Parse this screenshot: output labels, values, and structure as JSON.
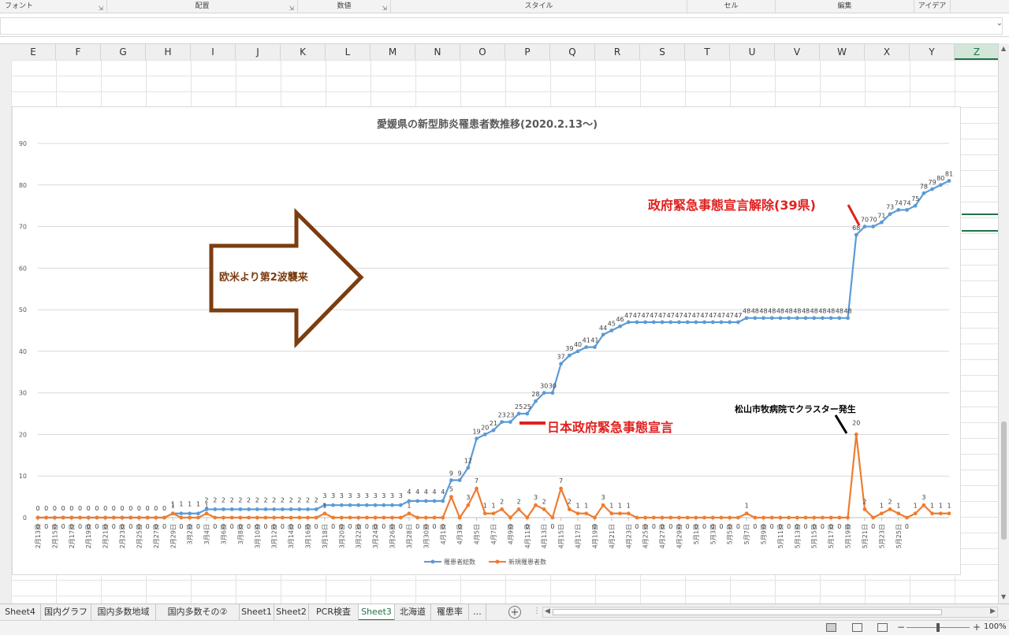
{
  "ribbon": {
    "groups": [
      "フォント",
      "配置",
      "数値",
      "スタイル",
      "セル",
      "編集",
      "アイデア"
    ]
  },
  "columns": [
    "E",
    "F",
    "G",
    "H",
    "I",
    "J",
    "K",
    "L",
    "M",
    "N",
    "O",
    "P",
    "Q",
    "R",
    "S",
    "T",
    "U",
    "V",
    "W",
    "X",
    "Y",
    "Z"
  ],
  "selected_column": "Z",
  "sheets": [
    "Sheet4",
    "国内グラフ",
    "国内多数地域",
    "国内多数その②",
    "Sheet1",
    "Sheet2",
    "PCR検査",
    "Sheet3",
    "北海道",
    "罹患率",
    "..."
  ],
  "active_sheet": "Sheet3",
  "status": {
    "zoom": "100%",
    "zoom_minus": "−",
    "zoom_plus": "+"
  },
  "colors": {
    "excel_green": "#217346",
    "series_total": "#5b9bd5",
    "series_new": "#ed7d31",
    "annotation_red": "#e0211f",
    "arrow_brown": "#7b3d10"
  },
  "chart_data": {
    "type": "line",
    "title": "愛媛県の新型肺炎罹患者数推移(2020.2.13〜)",
    "ylim": [
      0,
      90
    ],
    "yticks": [
      0,
      10,
      20,
      30,
      40,
      50,
      60,
      70,
      80,
      90
    ],
    "grid": true,
    "legend_position": "bottom",
    "x_start_date": "2020-02-13",
    "x_labels": [
      "2月13日",
      "2月15日",
      "2月17日",
      "2月19日",
      "2月21日",
      "2月23日",
      "2月25日",
      "2月27日",
      "2月29日",
      "3月2日",
      "3月4日",
      "3月6日",
      "3月8日",
      "3月10日",
      "3月12日",
      "3月14日",
      "3月16日",
      "3月18日",
      "3月20日",
      "3月22日",
      "3月24日",
      "3月26日",
      "3月28日",
      "3月30日",
      "4月1日",
      "4月3日",
      "4月5日",
      "4月7日",
      "4月9日",
      "4月11日",
      "4月13日",
      "4月15日",
      "4月17日",
      "4月19日",
      "4月21日",
      "4月23日",
      "4月25日",
      "4月27日",
      "4月29日",
      "5月1日",
      "5月3日",
      "5月5日",
      "5月7日",
      "5月9日",
      "5月11日",
      "5月13日",
      "5月15日",
      "5月17日",
      "5月19日",
      "5月21日",
      "5月23日",
      "5月25日"
    ],
    "series": [
      {
        "name": "罹患者総数",
        "color": "#5b9bd5",
        "values": [
          0,
          0,
          0,
          0,
          0,
          0,
          0,
          0,
          0,
          0,
          0,
          0,
          0,
          0,
          0,
          0,
          1,
          1,
          1,
          1,
          2,
          2,
          2,
          2,
          2,
          2,
          2,
          2,
          2,
          2,
          2,
          2,
          2,
          2,
          3,
          3,
          3,
          3,
          3,
          3,
          3,
          3,
          3,
          3,
          4,
          4,
          4,
          4,
          4,
          9,
          9,
          12,
          19,
          20,
          21,
          23,
          23,
          25,
          25,
          28,
          30,
          30,
          37,
          39,
          40,
          41,
          41,
          44,
          45,
          46,
          47,
          47,
          47,
          47,
          47,
          47,
          47,
          47,
          47,
          47,
          47,
          47,
          47,
          47,
          48,
          48,
          48,
          48,
          48,
          48,
          48,
          48,
          48,
          48,
          48,
          48,
          48,
          68,
          70,
          70,
          71,
          73,
          74,
          74,
          75,
          78,
          79,
          80,
          81
        ]
      },
      {
        "name": "新規罹患者数",
        "color": "#ed7d31",
        "values": [
          0,
          0,
          0,
          0,
          0,
          0,
          0,
          0,
          0,
          0,
          0,
          0,
          0,
          0,
          0,
          0,
          1,
          0,
          0,
          0,
          1,
          0,
          0,
          0,
          0,
          0,
          0,
          0,
          0,
          0,
          0,
          0,
          0,
          0,
          1,
          0,
          0,
          0,
          0,
          0,
          0,
          0,
          0,
          0,
          1,
          0,
          0,
          0,
          0,
          5,
          0,
          3,
          7,
          1,
          1,
          2,
          0,
          2,
          0,
          3,
          2,
          0,
          7,
          2,
          1,
          1,
          0,
          3,
          1,
          1,
          1,
          0,
          0,
          0,
          0,
          0,
          0,
          0,
          0,
          0,
          0,
          0,
          0,
          0,
          1,
          0,
          0,
          0,
          0,
          0,
          0,
          0,
          0,
          0,
          0,
          0,
          0,
          20,
          2,
          0,
          1,
          2,
          1,
          0,
          1,
          3,
          1,
          1,
          1
        ]
      }
    ],
    "annotations": {
      "arrow_text": "欧米より第2波襲来",
      "emergency": "日本政府緊急事態宣言",
      "lift": "政府緊急事態宣言解除(39県)",
      "cluster": "松山市牧病院でクラスター発生"
    }
  }
}
